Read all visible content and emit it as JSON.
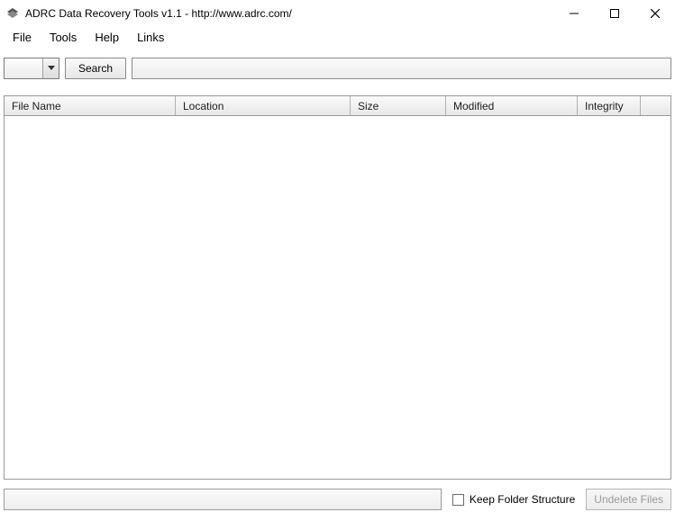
{
  "window": {
    "title": "ADRC Data Recovery Tools v1.1 - http://www.adrc.com/"
  },
  "menubar": {
    "items": [
      "File",
      "Tools",
      "Help",
      "Links"
    ]
  },
  "toolbar": {
    "drive_selected": "",
    "search_label": "Search",
    "path_value": ""
  },
  "table": {
    "columns": [
      "File Name",
      "Location",
      "Size",
      "Modified",
      "Integrity"
    ],
    "rows": []
  },
  "footer": {
    "status_text": "",
    "keep_folder_label": "Keep Folder Structure",
    "keep_folder_checked": false,
    "undelete_label": "Undelete Files"
  }
}
